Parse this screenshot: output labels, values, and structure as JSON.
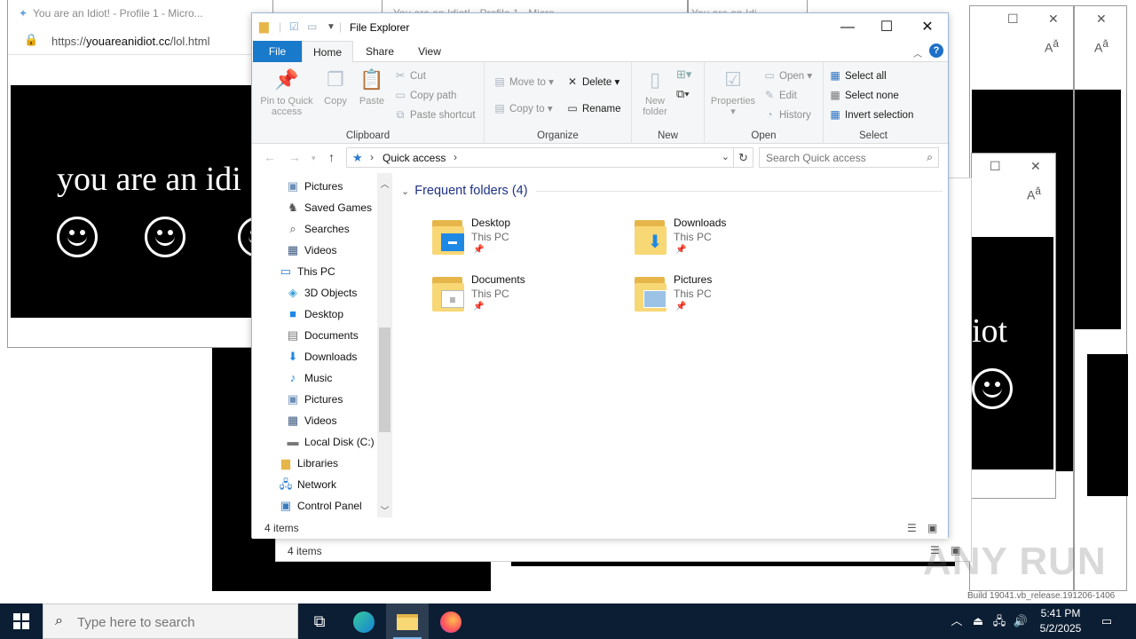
{
  "browser": {
    "title": "You are an Idiot! - Profile 1 - Micro...",
    "url": "https://youareanidiot.cc/lol.html",
    "url_prefix": "https://",
    "url_domain": "youareanidiot.cc",
    "url_path": "/lol.html",
    "ghost_title": "You are an Idiot! - Profile 1 - Micro...",
    "ghost_title_short": "You are an Idi",
    "panel_text": "you are an idiot",
    "panel_text_clipped": "you are an idi",
    "panel_text_tail": "iot"
  },
  "explorer": {
    "title": "File Explorer",
    "tabs": {
      "file": "File",
      "home": "Home",
      "share": "Share",
      "view": "View"
    },
    "ribbon": {
      "clipboard": {
        "label": "Clipboard",
        "pin": "Pin to Quick access",
        "pin_line1": "Pin to Quick",
        "pin_line2": "access",
        "copy": "Copy",
        "paste": "Paste",
        "cut": "Cut",
        "copy_path": "Copy path",
        "paste_shortcut": "Paste shortcut"
      },
      "organize": {
        "label": "Organize",
        "move_to": "Move to",
        "copy_to": "Copy to",
        "delete": "Delete",
        "rename": "Rename"
      },
      "new": {
        "label": "New",
        "new_folder_line1": "New",
        "new_folder_line2": "folder"
      },
      "open": {
        "label": "Open",
        "properties": "Properties",
        "open": "Open",
        "edit": "Edit",
        "history": "History"
      },
      "select": {
        "label": "Select",
        "select_all": "Select all",
        "select_none": "Select none",
        "invert": "Invert selection"
      }
    },
    "address": {
      "crumb": "Quick access",
      "search_placeholder": "Search Quick access"
    },
    "nav": [
      "Pictures",
      "Saved Games",
      "Searches",
      "Videos",
      "This PC",
      "3D Objects",
      "Desktop",
      "Documents",
      "Downloads",
      "Music",
      "Pictures",
      "Videos",
      "Local Disk (C:)",
      "Libraries",
      "Network",
      "Control Panel"
    ],
    "section": "Frequent folders (4)",
    "folders": [
      {
        "name": "Desktop",
        "location": "This PC"
      },
      {
        "name": "Downloads",
        "location": "This PC"
      },
      {
        "name": "Documents",
        "location": "This PC"
      },
      {
        "name": "Pictures",
        "location": "This PC"
      }
    ],
    "status": "4 items"
  },
  "taskbar": {
    "search_placeholder": "Type here to search",
    "time": "5:41 PM",
    "date": "5/2/2025"
  },
  "watermark": "ANY RUN",
  "build": "Build 19041.vb_release.191206-1406",
  "colors": {
    "accent": "#1979ca",
    "taskbar": "#0b1e33",
    "section_head": "#1e3287",
    "folder": "#f8d775"
  }
}
